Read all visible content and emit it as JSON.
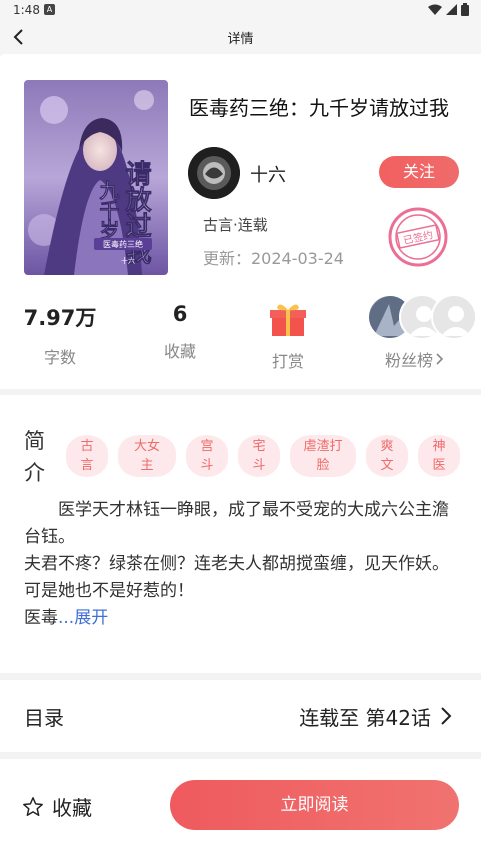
{
  "status_bar": {
    "time": "1:48",
    "notification": "A"
  },
  "header": {
    "title": "详情"
  },
  "book": {
    "title": "医毒药三绝：九千岁请放过我",
    "author": "十六",
    "follow_label": "关注",
    "genre": "古言·连载",
    "update": "更新：2024-03-24",
    "cover_text": "请放过我",
    "cover_subtitle": "九千岁",
    "cover_series": "医毒药三绝",
    "cover_author": "十六",
    "stamp_text": "已签约"
  },
  "stats": {
    "words": {
      "value": "7.97万",
      "label": "字数"
    },
    "favorites": {
      "value": "6",
      "label": "收藏"
    },
    "reward": {
      "label": "打赏"
    },
    "fans": {
      "label": "粉丝榜"
    }
  },
  "intro": {
    "title": "简介",
    "tags": [
      "古言",
      "大女主",
      "宫斗",
      "宅斗",
      "虐渣打脸",
      "爽文",
      "神医"
    ],
    "lines": [
      "医学天才林钰一睁眼，成了最不受宠的大成六公主澹台钰。",
      "夫君不疼？绿茶在侧？连老夫人都胡搅蛮缠，见天作妖。",
      "可是她也不是好惹的！"
    ],
    "last_line": "医毒",
    "expand_label": "...展开"
  },
  "toc": {
    "label": "目录",
    "status": "连载至 第42话"
  },
  "bottom": {
    "favorite_label": "收藏",
    "read_label": "立即阅读"
  },
  "colors": {
    "accent": "#ef5f62",
    "tag_bg": "#fde9eb",
    "tag_text": "#f06a6a",
    "link": "#3f6fd8"
  }
}
